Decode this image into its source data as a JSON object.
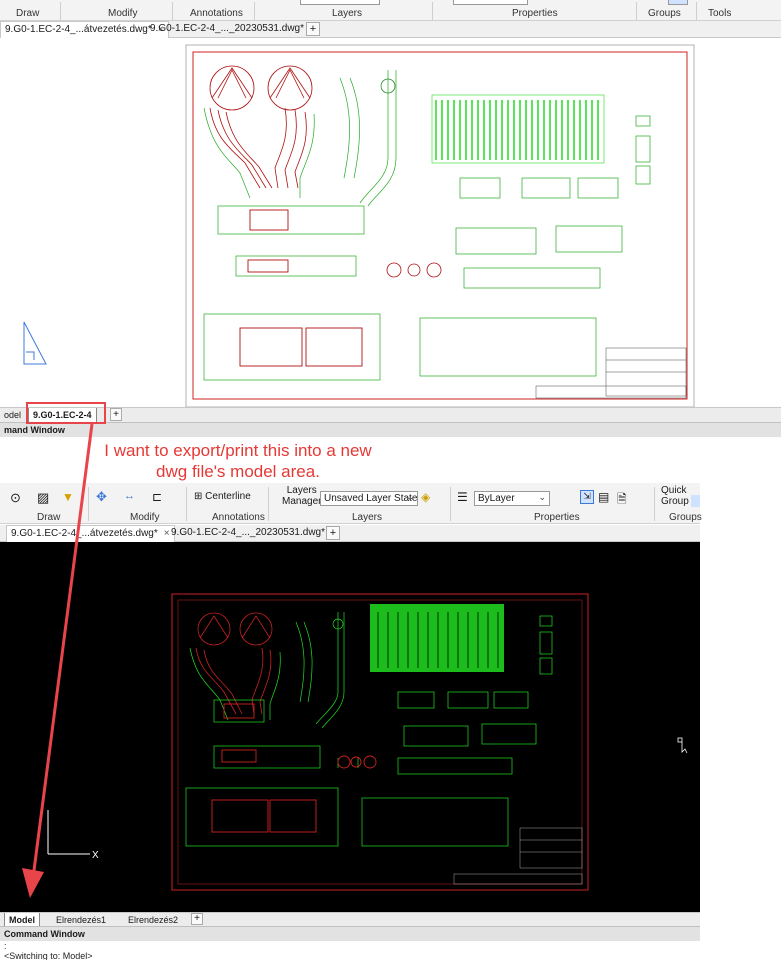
{
  "top": {
    "ribbon_groups": [
      "Draw",
      "Modify",
      "Annotations",
      "Layers",
      "Properties",
      "Groups",
      "Tools"
    ],
    "doc_tabs": [
      {
        "label": "9.G0-1.EC-2-4_...átvezetés.dwg*",
        "close": "×"
      },
      {
        "label": "9.G0-1.EC-2-4_..._20230531.dwg*",
        "close": "×"
      }
    ],
    "new_tab": "+",
    "layout_tabs": [
      "odel",
      "9.G0-1.EC-2-4"
    ],
    "layout_new": "+",
    "command_window": "mand Window"
  },
  "annotation": {
    "line1": "I want to export/print this into a new",
    "line2": "dwg file's model area.",
    "color": "#e53935"
  },
  "bottom": {
    "ribbon": {
      "centerline": "Centerline",
      "layers_manager_1": "Layers",
      "layers_manager_2": "Manager",
      "layer_state": "Unsaved Layer State",
      "bylayer": "ByLayer",
      "quick_group_1": "Quick",
      "quick_group_2": "Group",
      "groups": [
        "Draw",
        "Modify",
        "Annotations",
        "Layers",
        "Properties",
        "Groups"
      ]
    },
    "doc_tabs": [
      {
        "label": "9.G0-1.EC-2-4_...átvezetés.dwg*",
        "close": "×"
      },
      {
        "label": "9.G0-1.EC-2-4_..._20230531.dwg*",
        "close": "×"
      }
    ],
    "new_tab": "+",
    "axis_x": "X",
    "layout_tabs": [
      "Model",
      "Elrendezés1",
      "Elrendezés2"
    ],
    "layout_new": "+",
    "command_window": "Command Window",
    "command_lines": [
      ":",
      "<Switching to: Model>"
    ]
  },
  "colors": {
    "drawing_green": "#22dd22",
    "border_red": "#cc2222",
    "detail_red": "#b01010",
    "canvas_black": "#000000",
    "accent_blue": "#3c78d8"
  }
}
